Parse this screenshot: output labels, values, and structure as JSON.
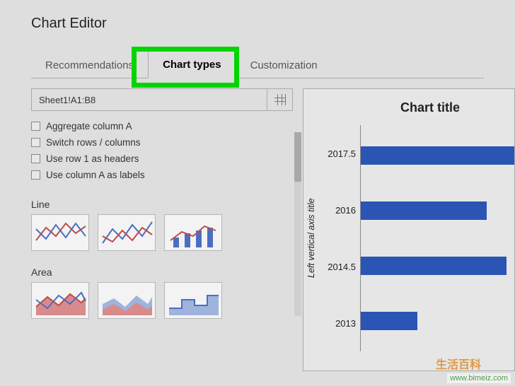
{
  "title": "Chart Editor",
  "tabs": {
    "recommendations": "Recommendations",
    "chart_types": "Chart types",
    "customization": "Customization"
  },
  "range": {
    "value": "Sheet1!A1:B8",
    "grid_icon": "grid-select-icon"
  },
  "options": {
    "aggregate": "Aggregate column A",
    "switch": "Switch rows / columns",
    "row1headers": "Use row 1 as headers",
    "colAlabels": "Use column A as labels"
  },
  "sections": {
    "line": "Line",
    "area": "Area"
  },
  "chart_data": {
    "type": "bar",
    "orientation": "horizontal",
    "title": "Chart title",
    "ylabel": "Left vertical axis title",
    "categories": [
      "2017.5",
      "2016",
      "2014.5",
      "2013"
    ],
    "values": [
      95,
      78,
      90,
      35
    ],
    "bar_color": "#2a55b5"
  },
  "watermark": {
    "badge": "生活百科",
    "url": "www.bimeiz.com"
  }
}
